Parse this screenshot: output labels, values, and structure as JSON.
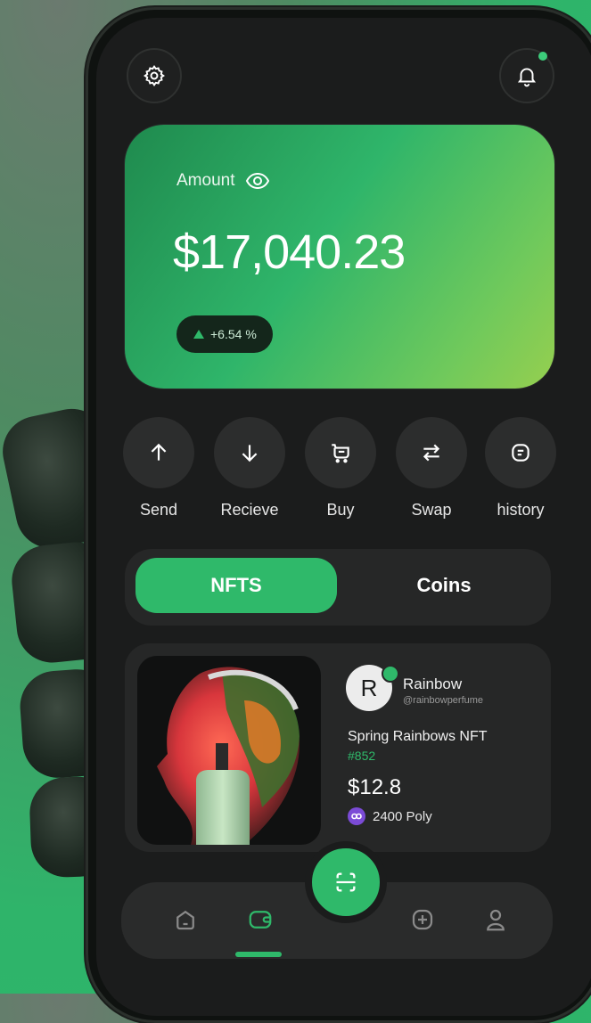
{
  "colors": {
    "accent": "#2fb96a",
    "card_gradient_start": "#1f8a4e",
    "card_gradient_end": "#96cf4f",
    "screen_bg": "#1b1c1c",
    "surface": "#262727",
    "poly_badge": "#7b4bd6"
  },
  "header": {
    "settings_icon": "gear-icon",
    "notification_icon": "bell-icon",
    "has_notification": true
  },
  "balance_card": {
    "label": "Amount",
    "visibility_icon": "eye-icon",
    "amount": "$17,040.23",
    "change": "+6.54 %",
    "change_icon": "triangle-up-icon"
  },
  "actions": [
    {
      "label": "Send",
      "icon": "arrow-up-icon"
    },
    {
      "label": "Recieve",
      "icon": "arrow-down-icon"
    },
    {
      "label": "Buy",
      "icon": "cart-icon"
    },
    {
      "label": "Swap",
      "icon": "swap-icon"
    },
    {
      "label": "history",
      "icon": "history-icon"
    }
  ],
  "tabs": {
    "nfts": "NFTS",
    "coins": "Coins",
    "active": "nfts"
  },
  "nft": {
    "avatar_letter": "R",
    "creator": "Rainbow",
    "handle": "@rainbowperfume",
    "title": "Spring Rainbows NFT",
    "id": "#852",
    "price": "$12.8",
    "poly": "2400 Poly"
  },
  "bottom_nav": {
    "items": [
      "home-icon",
      "wallet-icon",
      "scan-icon",
      "add-icon",
      "profile-icon"
    ],
    "active": "wallet-icon"
  }
}
